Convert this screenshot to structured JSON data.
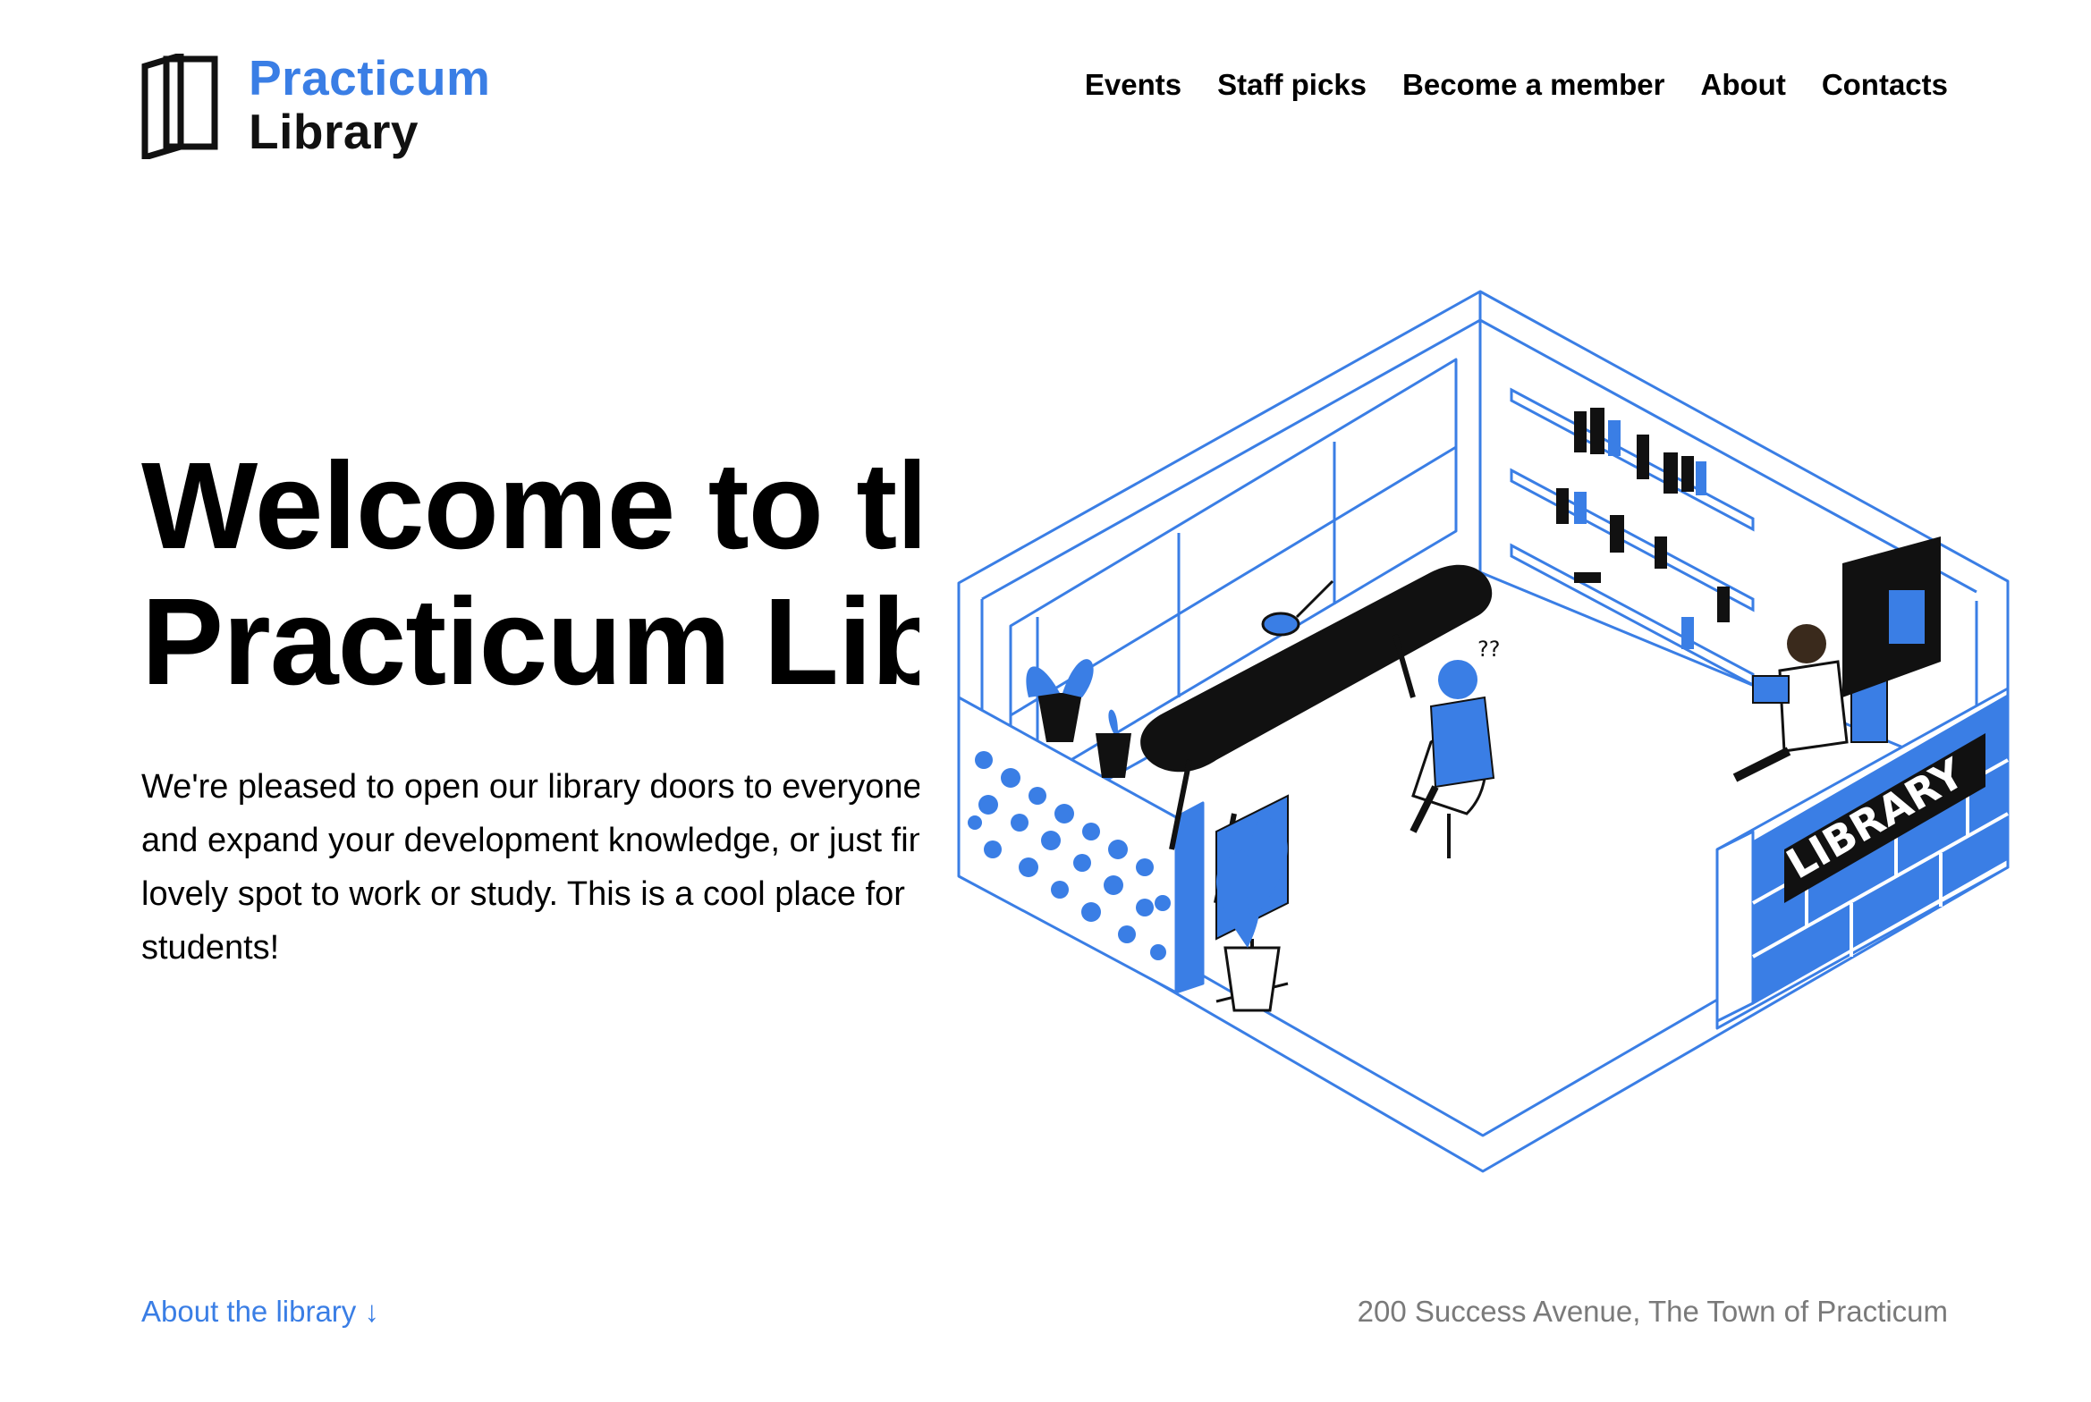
{
  "logo": {
    "line1": "Practicum",
    "line2": "Library"
  },
  "nav": [
    "Events",
    "Staff picks",
    "Become a member",
    "About",
    "Contacts"
  ],
  "hero": {
    "title": [
      "Welcome to the",
      "Practicum Library"
    ],
    "paragraph": [
      "We're pleased to open our library doors to everyone",
      "and expand your development knowledge, or just find a",
      "lovely spot to work or study. This is a cool place for",
      "students!"
    ]
  },
  "illustration": {
    "sign_text": "LIBRARY"
  },
  "footer": {
    "about_link": "About the library ↓",
    "address": "200 Success Avenue, The Town of Practicum"
  },
  "colors": {
    "accent": "#3a7ee5",
    "text": "#000000",
    "muted": "#7a7a7a",
    "background": "#ffffff"
  }
}
